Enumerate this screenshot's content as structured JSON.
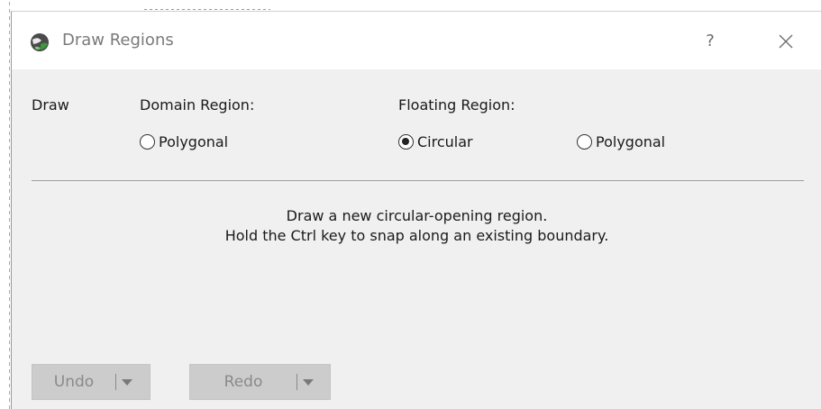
{
  "window": {
    "title": "Draw Regions",
    "help": "?",
    "close_icon": "close-icon"
  },
  "draw_label": "Draw",
  "domain_region": {
    "label": "Domain Region:",
    "options": [
      {
        "label": "Polygonal",
        "checked": false
      }
    ]
  },
  "floating_region": {
    "label": "Floating Region:",
    "options": [
      {
        "label": "Circular",
        "checked": true
      },
      {
        "label": "Polygonal",
        "checked": false
      }
    ]
  },
  "message": {
    "line1": "Draw a new circular-opening region.",
    "line2": "Hold the Ctrl key to snap along an existing boundary."
  },
  "buttons": {
    "undo": "Undo",
    "redo": "Redo",
    "enabled": false
  },
  "colors": {
    "dialog_bg": "#f0f0f0",
    "titlebar_bg": "#ffffff",
    "disabled_button_bg": "#cccccc",
    "disabled_text": "#8a8a8a"
  }
}
